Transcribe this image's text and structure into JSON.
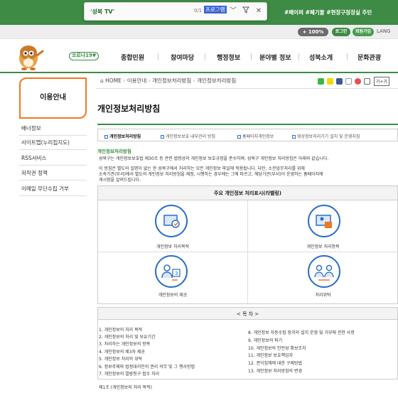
{
  "top_bar": {
    "ticker_text": "#페이퍼     #폐기물     #현장구청장실 주민",
    "find": {
      "query_label": "'성북 TV'",
      "input_value": "프로그램",
      "count": "0/1"
    }
  },
  "util": {
    "font_size": "+ 100% ",
    "login": "로그인",
    "join": "회원가입",
    "lang": "LANG"
  },
  "header": {
    "corona_label": "코로나19▼",
    "nav": [
      "종합민원",
      "참여마당",
      "행정정보",
      "분야별 정보",
      "성북소개",
      "문화관광"
    ]
  },
  "sidebar": {
    "title": "이용안내",
    "items": [
      "배너정보",
      "사이트맵(누리집지도)",
      "RSS서비스",
      "저작권 정책",
      "이메일 무단수집 거부"
    ]
  },
  "breadcrumb": {
    "home": "HOME",
    "items": [
      "이용안내",
      "개인정보처리방침",
      "개인정보처리방침"
    ],
    "font_btn": "가+가"
  },
  "page": {
    "title": "개인정보처리방침",
    "tabs": [
      "개인정보처리방침",
      "개인정보보호 내부관리 방침",
      "홈페이지개인정보",
      "영상정보처리기기 설치 및 운영지침"
    ],
    "section_heading": "개인정보처리방침",
    "intro": "성북구는 개인정보보호법 제30조 등 관련 법령상의 개인정보 보호규정을 준수하며, 성북구 개인정보 처리방침은 아래와 같습니다.",
    "para_lines": [
      "이 방침은 별도의 설명이 없는 한 성북구에서 처리하는 모든 개인정보 파일에 적용됩니다. 다만, 소관업무처리를 위해",
      "소속기관(부서)에서 별도의 개인정보 처리방침을 제정, 시행하는 경우에는 그에 따르고, 해당기관(부서)이 운영하는 홈페이지에",
      "게시함을 알려드립니다."
    ],
    "label_box": {
      "heading": "주요 개인정보 처리표시(라벨링)",
      "items": [
        "개인정보 처리목적",
        "개인정보 처리항목",
        "개인정보의 제공",
        "처리위탁"
      ]
    },
    "toc": {
      "heading": "< 목 차 >",
      "left": [
        "1. 개인정보의 처리 목적",
        "2. 개인정보의 처리 및 보유기간",
        "3. 처리하는 개인정보의 항목",
        "4. 개인정보의 제3자 제공",
        "5. 개인정보 처리의 위탁",
        "6. 정보주체와 법정대리인의 권리 의무 및 그 행사방법",
        "7. 개인정보의 열람청구 접수 처리"
      ],
      "right": [
        "8. 개인정보 자동수집 장치의 설치 운영 및 거부에 관한 사항",
        "9. 개인정보의 파기",
        "10. 개인정보의 안전성 확보조치",
        "11. 개인정보 보호책임자",
        "12. 권익침해에 대한 구제방법",
        "13. 개인정보 처리방침의 변경"
      ]
    },
    "bottom_text": "제1조 (개인정보의 처리 목적)"
  },
  "colors": {
    "brand_green": "#3d8b44",
    "accent_orange": "#f07820",
    "icon_blue": "#2a6fc9"
  }
}
